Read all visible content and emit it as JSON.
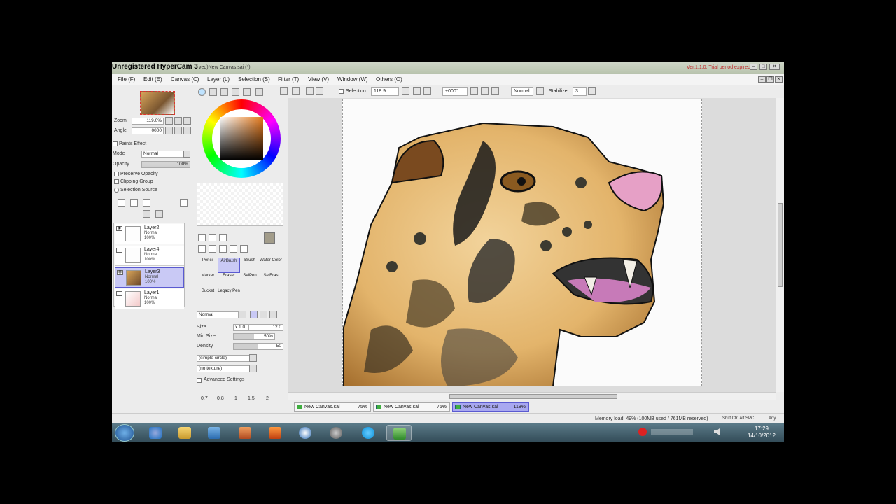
{
  "window": {
    "hypercam_watermark": "Unregistered HyperCam 3",
    "title_suffix": "ved)New Canvas.sai (*)",
    "version_notice": "Ver.1.1.0: Trial period expired"
  },
  "menu": [
    "File (F)",
    "Edit (E)",
    "Canvas (C)",
    "Layer (L)",
    "Selection (S)",
    "Filter (T)",
    "View (V)",
    "Window (W)",
    "Others (O)"
  ],
  "toolbar": {
    "selection_label": "Selection",
    "zoom_value": "118.9...",
    "angle_value": "+000°",
    "blend_mode": "Normal",
    "stabilizer_label": "Stabilizer",
    "stabilizer_value": "3"
  },
  "navigator": {
    "zoom_label": "Zoom",
    "zoom_value": "119.0%",
    "angle_label": "Angle",
    "angle_value": "+0000"
  },
  "layer_props": {
    "paints_effect": "Paints Effect",
    "mode_label": "Mode",
    "mode_value": "Normal",
    "opacity_label": "Opacity",
    "opacity_value": "100%",
    "preserve_opacity": "Preserve Opacity",
    "clipping_group": "Clipping Group",
    "selection_source": "Selection Source"
  },
  "layers": [
    {
      "name": "Layer2",
      "mode": "Normal",
      "opacity": "100%"
    },
    {
      "name": "Layer4",
      "mode": "Normal",
      "opacity": "100%"
    },
    {
      "name": "Layer3",
      "mode": "Normal",
      "opacity": "100%"
    },
    {
      "name": "Layer1",
      "mode": "Normal",
      "opacity": "100%"
    }
  ],
  "tools": [
    [
      "Pencil",
      "AirBrush",
      "Brush",
      "Water Color"
    ],
    [
      "Marker",
      "Eraser",
      "SelPen",
      "SelEras"
    ],
    [
      "Bucket",
      "Legacy Pen",
      "",
      ""
    ]
  ],
  "brush": {
    "blend_mode": "Normal",
    "size_label": "Size",
    "size_mult": "x 1.0",
    "size_value": "12.0",
    "min_size_label": "Min Size",
    "min_size_value": "50%",
    "density_label": "Density",
    "density_value": "50",
    "shape": "(simple circle)",
    "texture": "(no texture)",
    "advanced": "Advanced Settings",
    "presets": [
      "0.7",
      "0.8",
      "1",
      "1.5",
      "2"
    ]
  },
  "tabs": [
    {
      "name": "New Canvas.sai",
      "zoom": "75%"
    },
    {
      "name": "New Canvas.sai",
      "zoom": "75%"
    },
    {
      "name": "New Canvas.sai",
      "zoom": "118%"
    }
  ],
  "status": {
    "memory": "Memory load: 49% (100MB used / 761MB reserved)",
    "keys": "Shift Ctrl Alt SPC",
    "any": "Any"
  },
  "taskbar": {
    "time": "17:29",
    "date": "14/10/2012"
  }
}
